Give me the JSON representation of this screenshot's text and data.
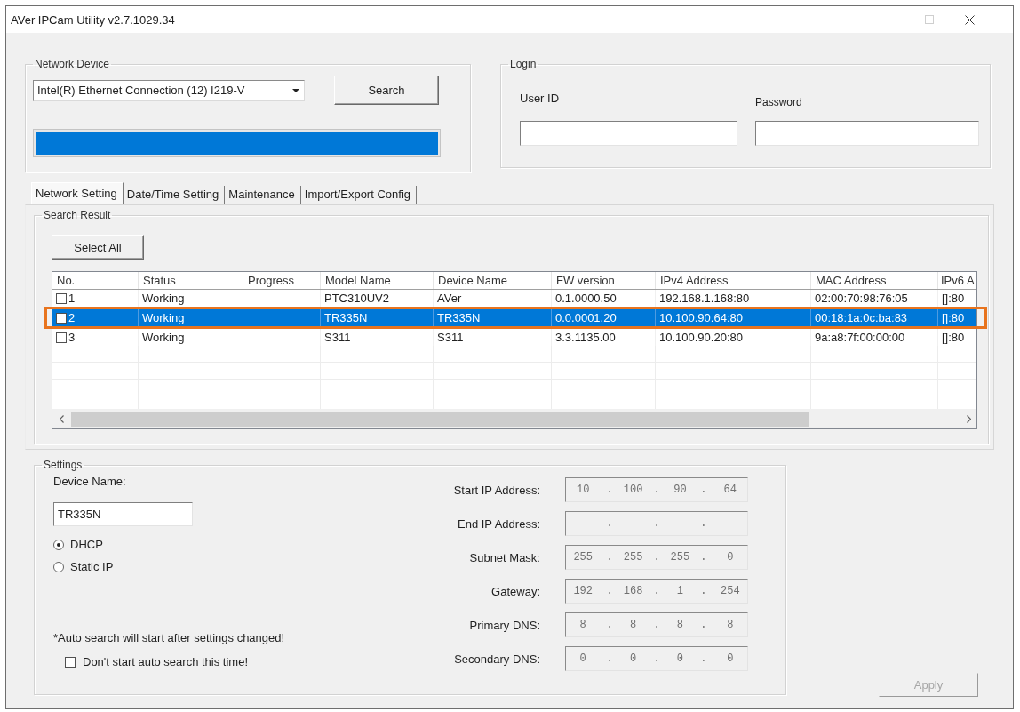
{
  "window": {
    "title": "AVer IPCam Utility v2.7.1029.34",
    "controls": [
      {
        "kind": "minimize",
        "disabled": false
      },
      {
        "kind": "maximize",
        "disabled": true
      },
      {
        "kind": "close",
        "disabled": false
      }
    ]
  },
  "network_device": {
    "title": "Network Device",
    "adapter": "Intel(R) Ethernet Connection (12) I219-V",
    "search_button": "Search",
    "progress": {
      "level": 1
    }
  },
  "login": {
    "title": "Login",
    "user_id": {
      "label": "User ID"
    },
    "password": {
      "label": "Password"
    }
  },
  "tabs": [
    {
      "label": "Network Setting",
      "selected": true
    },
    {
      "label": "Date/Time Setting",
      "selected": false
    },
    {
      "label": "Maintenance",
      "selected": false
    },
    {
      "label": "Import/Export Config",
      "selected": false
    }
  ],
  "search_result": {
    "title": "Search Result",
    "select_all_button": "Select All",
    "table": {
      "columns": [
        "No.",
        "Status",
        "Progress",
        "Model Name",
        "Device Name",
        "FW version",
        "IPv4 Address",
        "MAC Address",
        "IPv6 A"
      ],
      "rows": [
        {
          "no": "1",
          "checked": false,
          "selected": false,
          "highlighted": false,
          "status": "Working",
          "model_name": "PTC310UV2",
          "device_name": "AVer",
          "fw_version": "0.1.0000.50",
          "ipv4_address": "192.168.1.168:80",
          "mac_address": "02:00:70:98:76:05",
          "ipv6_address": "[]:80"
        },
        {
          "no": "2",
          "checked": false,
          "selected": true,
          "highlighted": true,
          "status": "Working",
          "model_name": "TR335N",
          "device_name": "TR335N",
          "fw_version": "0.0.0001.20",
          "ipv4_address": "10.100.90.64:80",
          "mac_address": "00:18:1a:0c:ba:83",
          "ipv6_address": "[]:80"
        },
        {
          "no": "3",
          "checked": false,
          "selected": false,
          "highlighted": false,
          "status": "Working",
          "model_name": "S311",
          "device_name": "S311",
          "fw_version": "3.3.1135.00",
          "ipv4_address": "10.100.90.20:80",
          "mac_address": "9a:a8:7f:00:00:00",
          "ipv6_address": "[]:80"
        }
      ]
    }
  },
  "settings": {
    "title": "Settings",
    "device_name": {
      "label": "Device Name:",
      "value": "TR335N"
    },
    "address_modes": [
      {
        "label": "DHCP",
        "selected": true
      },
      {
        "label": "Static IP",
        "selected": false
      }
    ],
    "note": "*Auto search will start after settings changed!",
    "skip_auto_search": {
      "label": "Don't start auto search this time!",
      "checked": false
    },
    "ip_fields": [
      {
        "label": "Start IP Address:",
        "value": "10 . 100 . 90 . 64",
        "disabled": true
      },
      {
        "label": "End IP Address:",
        "value": ". . .",
        "disabled": true
      },
      {
        "label": "Subnet Mask:",
        "value": "255 . 255 . 255 . 0",
        "disabled": true
      },
      {
        "label": "Gateway:",
        "value": "192 . 168 . 1 . 254",
        "disabled": true
      },
      {
        "label": "Primary DNS:",
        "value": "8 . 8 . 8 . 8",
        "disabled": true
      },
      {
        "label": "Secondary DNS:",
        "value": "0 . 0 . 0 . 0",
        "disabled": true
      }
    ]
  },
  "apply_button": {
    "label": "Apply",
    "disabled": true
  }
}
